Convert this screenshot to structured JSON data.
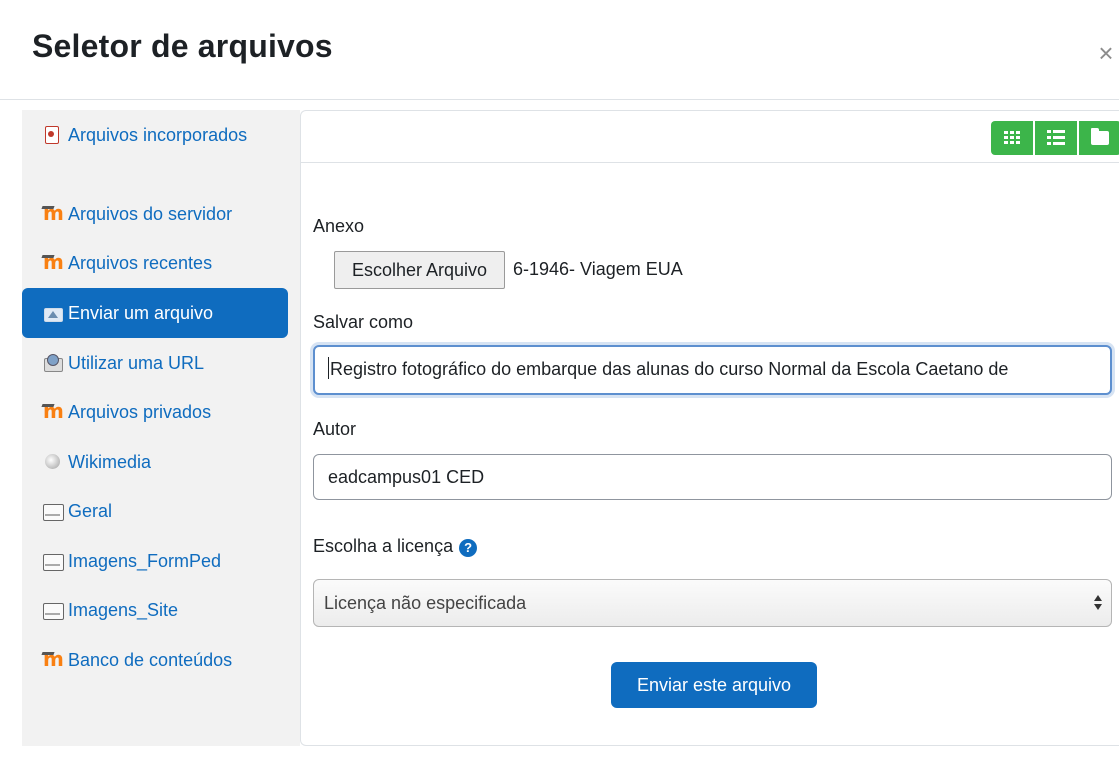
{
  "dialog": {
    "title": "Seletor de arquivos",
    "close_symbol": "×"
  },
  "sidebar": {
    "items": [
      {
        "label": "Arquivos incorporados",
        "icon": "pdf-file-icon",
        "active": false
      },
      {
        "label": "Arquivos do servidor",
        "icon": "moodle-icon",
        "active": false
      },
      {
        "label": "Arquivos recentes",
        "icon": "moodle-icon",
        "active": false
      },
      {
        "label": "Enviar um arquivo",
        "icon": "upload-icon",
        "active": true
      },
      {
        "label": "Utilizar uma URL",
        "icon": "url-icon",
        "active": false
      },
      {
        "label": "Arquivos privados",
        "icon": "moodle-icon",
        "active": false
      },
      {
        "label": "Wikimedia",
        "icon": "wikimedia-icon",
        "active": false
      },
      {
        "label": "Geral",
        "icon": "repository-box-icon",
        "active": false
      },
      {
        "label": "Imagens_FormPed",
        "icon": "repository-box-icon",
        "active": false
      },
      {
        "label": "Imagens_Site",
        "icon": "repository-box-icon",
        "active": false
      },
      {
        "label": "Banco de conteúdos",
        "icon": "moodle-icon",
        "active": false
      }
    ]
  },
  "toolbar": {
    "view_buttons": [
      "grid-view-icon",
      "list-view-icon",
      "folder-view-icon"
    ],
    "accent_color": "#3cb54a"
  },
  "form": {
    "attachment_label": "Anexo",
    "choose_file_label": "Escolher Arquivo",
    "chosen_file_name": "6-1946- Viagem EUA",
    "save_as_label": "Salvar como",
    "save_as_value": "Registro fotográfico do embarque das alunas do curso Normal da Escola Caetano de",
    "author_label": "Autor",
    "author_value": "eadcampus01 CED",
    "license_label": "Escolha a licença",
    "license_help_symbol": "?",
    "license_selected": "Licença não especificada",
    "submit_label": "Enviar este arquivo"
  },
  "colors": {
    "primary": "#0f6cbf",
    "sidebar_bg": "#f2f2f2"
  }
}
